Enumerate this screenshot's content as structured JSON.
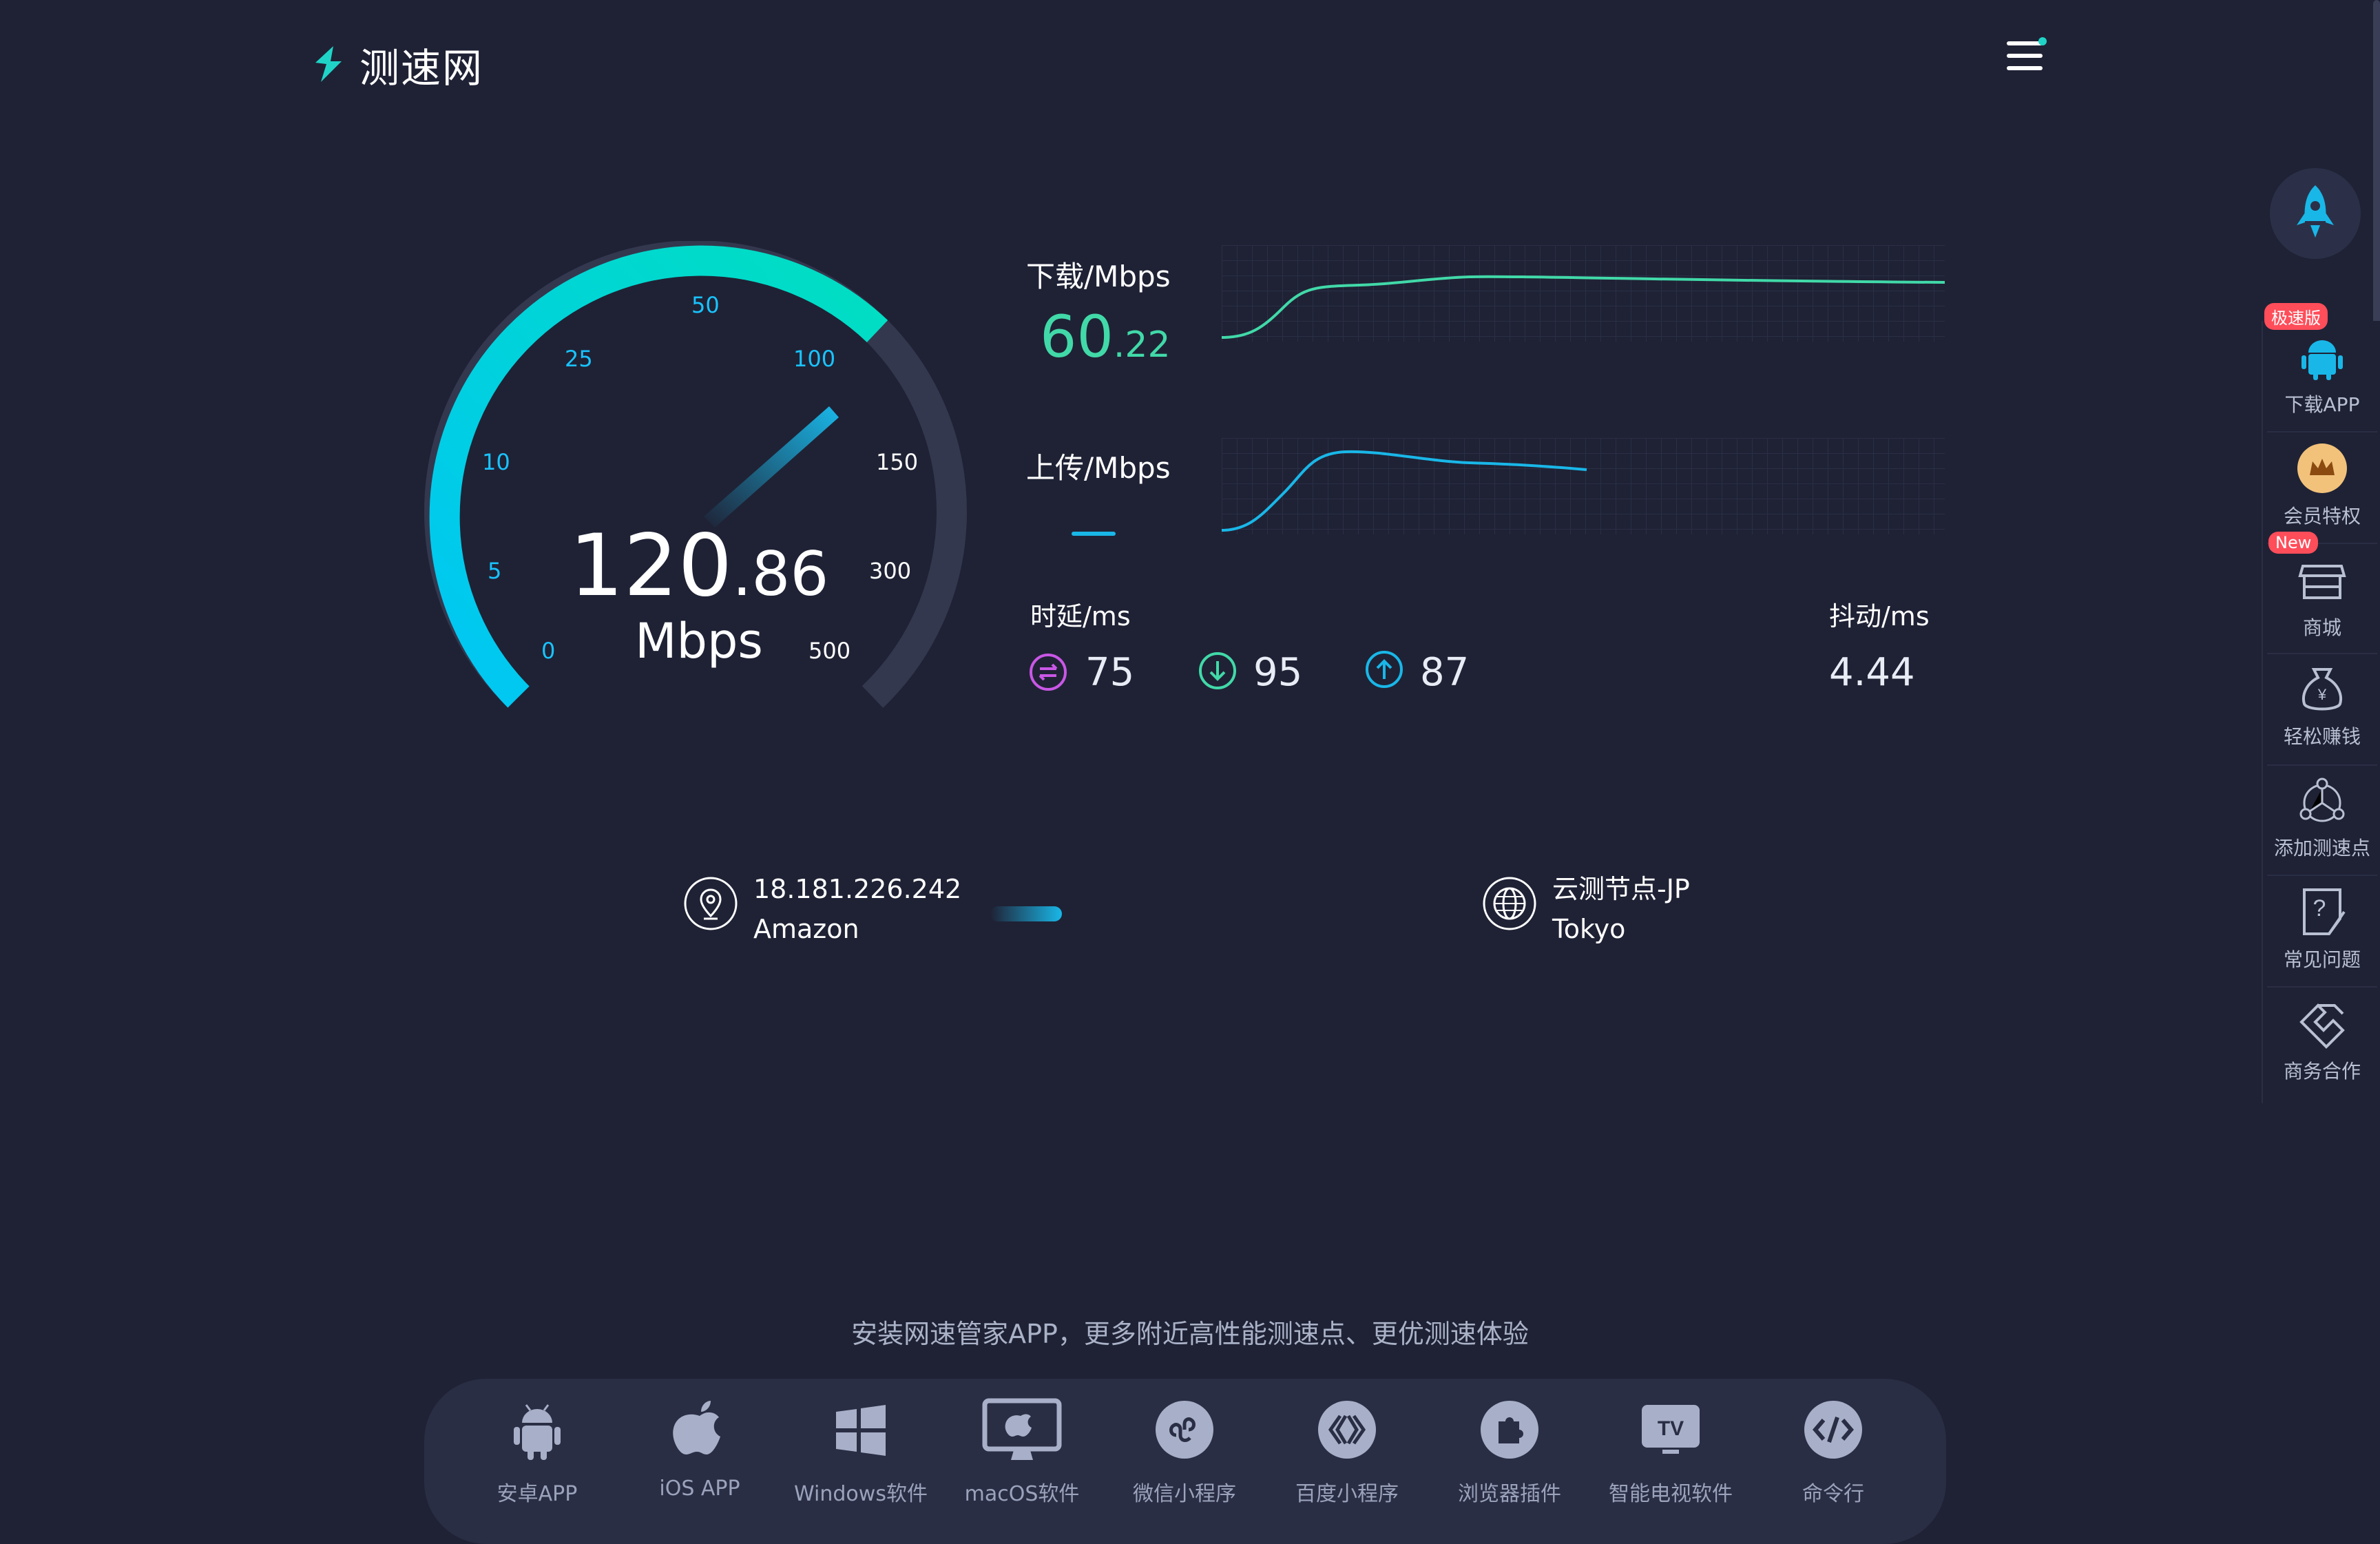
{
  "header": {
    "logo_text": "测速网"
  },
  "gauge": {
    "value_int": "120",
    "value_dec": ".86",
    "unit": "Mbps",
    "ticks": [
      "0",
      "5",
      "10",
      "25",
      "50",
      "100",
      "150",
      "300",
      "500"
    ]
  },
  "download": {
    "label": "下载/Mbps",
    "value_int": "60",
    "value_dec": ".22"
  },
  "upload": {
    "label": "上传/Mbps",
    "value": "—"
  },
  "latency": {
    "label": "时延/ms",
    "items": [
      {
        "icon": "swap-icon",
        "value": "75"
      },
      {
        "icon": "download-arrow-icon",
        "value": "95"
      },
      {
        "icon": "upload-arrow-icon",
        "value": "87"
      }
    ]
  },
  "jitter": {
    "label": "抖动/ms",
    "value": "4.44"
  },
  "client": {
    "ip": "18.181.226.242",
    "isp": "Amazon"
  },
  "server": {
    "name": "云测节点-JP",
    "city": "Tokyo"
  },
  "promo": "安装网速管家APP，更多附近高性能测速点、更优测速体验",
  "dock": [
    "安卓APP",
    "iOS APP",
    "Windows软件",
    "macOS软件",
    "微信小程序",
    "百度小程序",
    "浏览器插件",
    "智能电视软件",
    "命令行"
  ],
  "sidebar": {
    "items": [
      "下载APP",
      "会员特权",
      "商城",
      "轻松赚钱",
      "添加测速点",
      "常见问题",
      "商务合作"
    ],
    "badge_fast": "极速版",
    "badge_new": "New"
  },
  "colors": {
    "background": "#1f2235",
    "accent_teal": "#1fd4c7",
    "accent_cyan": "#19c3ff",
    "download": "#41d9a8",
    "upload": "#19b7e8"
  }
}
